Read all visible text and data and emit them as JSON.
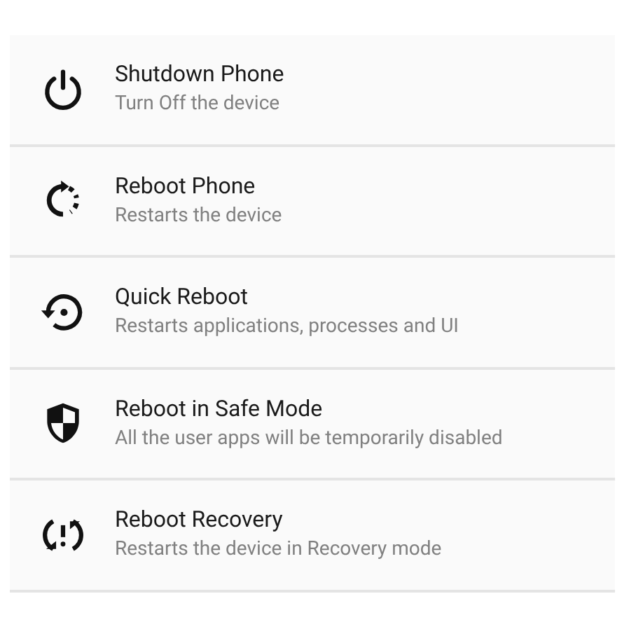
{
  "options": [
    {
      "kind": "power",
      "title": "Shutdown Phone",
      "subtitle": "Turn Off the device"
    },
    {
      "kind": "reboot",
      "title": "Reboot Phone",
      "subtitle": "Restarts the device"
    },
    {
      "kind": "quick",
      "title": "Quick Reboot",
      "subtitle": "Restarts applications, processes and UI"
    },
    {
      "kind": "safe",
      "title": "Reboot in Safe Mode",
      "subtitle": "All the user apps will be temporarily disabled"
    },
    {
      "kind": "recovery",
      "title": "Reboot Recovery",
      "subtitle": "Restarts the device in Recovery mode"
    }
  ]
}
